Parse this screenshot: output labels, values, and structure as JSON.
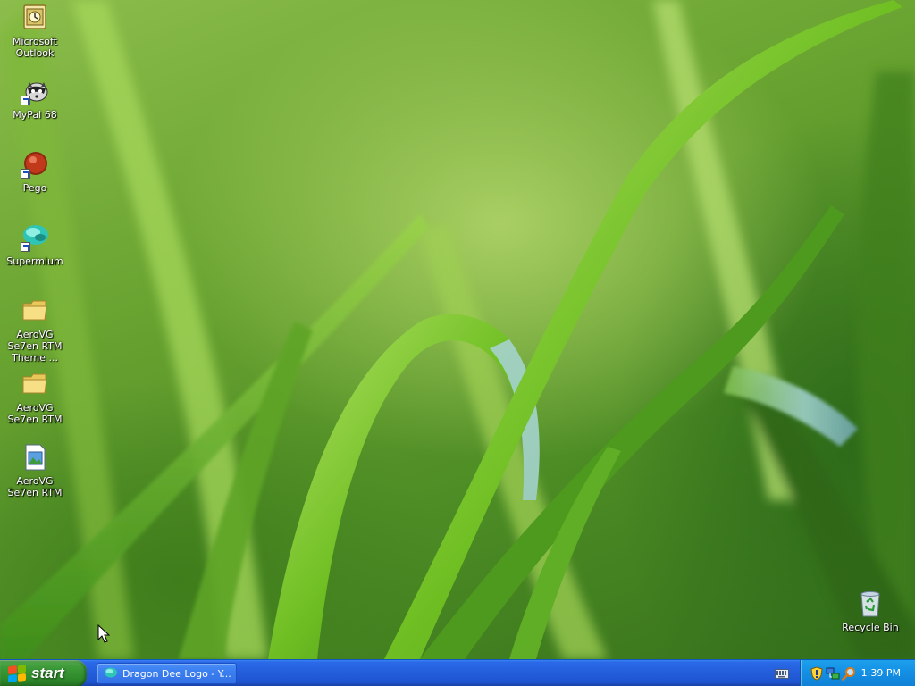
{
  "desktop": {
    "icons": [
      {
        "label": "Microsoft Outlook",
        "icon": "outlook-icon",
        "shortcut": false
      },
      {
        "label": "MyPal 68",
        "icon": "raccoon-icon",
        "shortcut": true
      },
      {
        "label": "Pego",
        "icon": "pego-icon",
        "shortcut": true
      },
      {
        "label": "Supermium",
        "icon": "supermium-icon",
        "shortcut": true
      },
      {
        "label": "AeroVG Se7en RTM Theme ...",
        "icon": "folder-icon",
        "shortcut": false
      },
      {
        "label": "AeroVG Se7en RTM",
        "icon": "folder-icon",
        "shortcut": false
      },
      {
        "label": "AeroVG Se7en RTM",
        "icon": "image-file-icon",
        "shortcut": false
      }
    ],
    "recycle_bin": {
      "label": "Recycle Bin",
      "icon": "recycle-bin-icon"
    }
  },
  "taskbar": {
    "start_label": "start",
    "task_button": {
      "label": "Dragon Dee Logo - Y...",
      "icon": "supermium-icon"
    },
    "quick_icons": [
      "keyboard-icon"
    ],
    "tray_icons": [
      "shield-icon",
      "network-icon",
      "search-icon"
    ],
    "clock": "1:39 PM"
  },
  "colors": {
    "taskbar_blue": "#245edb",
    "start_green": "#3c9a37",
    "tray_blue": "#1491e5",
    "wallpaper_green": "#6aa431"
  }
}
